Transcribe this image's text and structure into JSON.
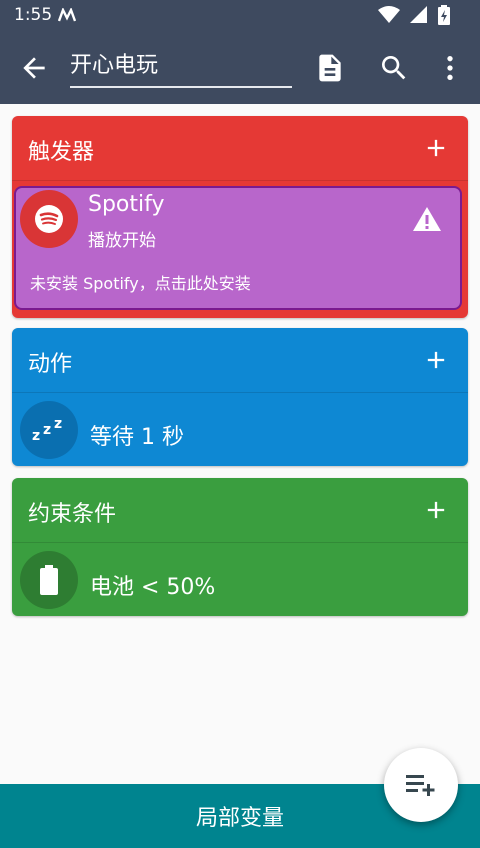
{
  "status_bar": {
    "time": "1:55"
  },
  "app_bar": {
    "title": "开心电玩"
  },
  "triggers": {
    "header": "触发器",
    "item": {
      "title": "Spotify",
      "subtitle": "播放开始",
      "warning": "未安装 Spotify，点击此处安装"
    }
  },
  "actions": {
    "header": "动作",
    "item": {
      "title": "等待 1 秒"
    }
  },
  "constraints": {
    "header": "约束条件",
    "item": {
      "title": "电池 < 50%"
    }
  },
  "bottom_bar": {
    "label": "局部变量"
  },
  "colors": {
    "app_bar": "#3e4a5f",
    "trigger": "#e53935",
    "trigger_item": "#b866cb",
    "action": "#0e88d3",
    "constraint": "#3a9e3f",
    "bottom_bar": "#00848f"
  },
  "icons": [
    "back-arrow-icon",
    "document-icon",
    "search-icon",
    "more-vert-icon",
    "add-icon",
    "spotify-icon",
    "warning-icon",
    "sleep-icon",
    "battery-icon",
    "playlist-add-icon"
  ]
}
